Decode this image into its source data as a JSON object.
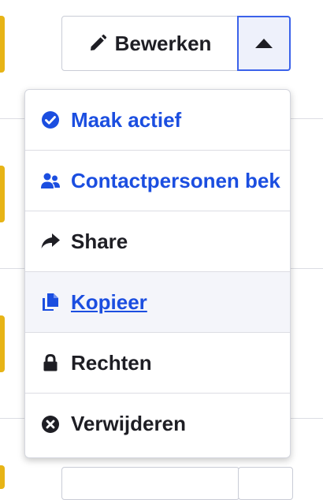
{
  "toolbar": {
    "edit_label": "Bewerken",
    "edit_icon": "pencil-icon",
    "toggle_icon": "caret-up-icon"
  },
  "menu": {
    "items": [
      {
        "label": "Maak actief",
        "icon": "check-circle-icon",
        "color": "#1b4ee0"
      },
      {
        "label": "Contactpersonen bek",
        "icon": "users-icon",
        "color": "#1b4ee0"
      },
      {
        "label": "Share",
        "icon": "share-arrow-icon",
        "color": "#1e1e24"
      },
      {
        "label": " Kopieer",
        "icon": "copy-icon",
        "color": "#1b4ee0",
        "hovered": true
      },
      {
        "label": "Rechten",
        "icon": "lock-icon",
        "color": "#1e1e24"
      },
      {
        "label": "Verwijderen",
        "icon": "x-circle-icon",
        "color": "#1e1e24"
      }
    ]
  },
  "colors": {
    "accent": "#1b4ee0",
    "status_yellow": "#e7b416",
    "focus_border": "#3b62ea"
  }
}
